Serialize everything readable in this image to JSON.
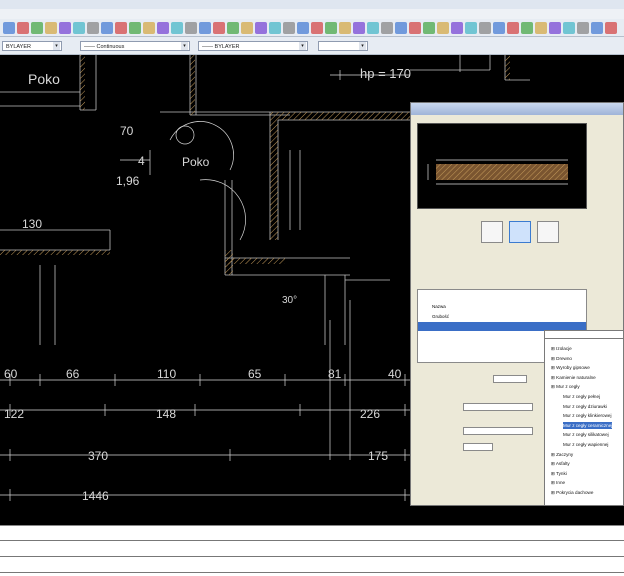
{
  "colors": {
    "canvas": "#000000",
    "wall_hatch": "#c49a5a",
    "dim": "#d8d8d8",
    "selection": "#3a6ec6"
  },
  "cad": {
    "labels": [
      "Poko",
      "hp = 170",
      "70",
      "4",
      "1,96",
      "Poko",
      "130",
      "60",
      "66",
      "110",
      "65",
      "81",
      "40",
      "122",
      "148",
      "226",
      "370",
      "175",
      "1446",
      "30°"
    ]
  },
  "dialog": {
    "row_name": "Nazwa",
    "row_thick": "Grubość"
  },
  "tree_items": [
    {
      "text": "Izolacje",
      "indent": 0
    },
    {
      "text": "Drewno",
      "indent": 0
    },
    {
      "text": "Wyroby gipsowe",
      "indent": 0
    },
    {
      "text": "Kamienie naturalne",
      "indent": 0
    },
    {
      "text": "Mur z cegły",
      "indent": 0
    },
    {
      "text": "Mur z cegły pełnej",
      "indent": 1
    },
    {
      "text": "Mur z cegły dziurawki",
      "indent": 1
    },
    {
      "text": "Mur z cegły klinkierowej",
      "indent": 1
    },
    {
      "text": "Mur z cegły ceramicznej",
      "indent": 1,
      "selected": true
    },
    {
      "text": "Mur z cegły silikatowej",
      "indent": 1
    },
    {
      "text": "Mur z cegły wapiennej",
      "indent": 1
    },
    {
      "text": "Zaczyny",
      "indent": 0
    },
    {
      "text": "Asfalty",
      "indent": 0
    },
    {
      "text": "Tynki",
      "indent": 0
    },
    {
      "text": "Inne",
      "indent": 0
    },
    {
      "text": "Pokrycia dachowe",
      "indent": 0
    }
  ]
}
